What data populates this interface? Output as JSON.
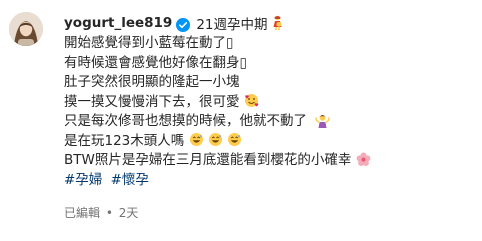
{
  "post": {
    "username": "yogurt_lee819",
    "caption_first": "21週孕中期",
    "lines": [
      "開始感覺得到小藍莓在動了▯",
      "有時候還會感覺他好像在翻身▯",
      "肚子突然很明顯的隆起一小塊",
      "摸一摸又慢慢消下去，很可愛",
      "只是每次修哥也想摸的時候，他就不動了",
      "是在玩123木頭人嗎",
      "BTW照片是孕婦在三月底還能看到櫻花的小確幸"
    ],
    "hashtags": [
      "#孕婦",
      "#懷孕"
    ],
    "meta": {
      "edited": "已編輯",
      "separator": "•",
      "time": "2天"
    },
    "icons": {
      "verified": "verified-badge-icon",
      "pregnant": "pregnant-woman-emoji",
      "hearts_face": "smiling-face-with-hearts-emoji",
      "shrug": "woman-shrugging-emoji",
      "laugh": "grinning-sweat-emoji",
      "blossom": "cherry-blossom-emoji"
    },
    "colors": {
      "link": "#00376b",
      "verified": "#0095f6",
      "meta": "#737373"
    }
  }
}
